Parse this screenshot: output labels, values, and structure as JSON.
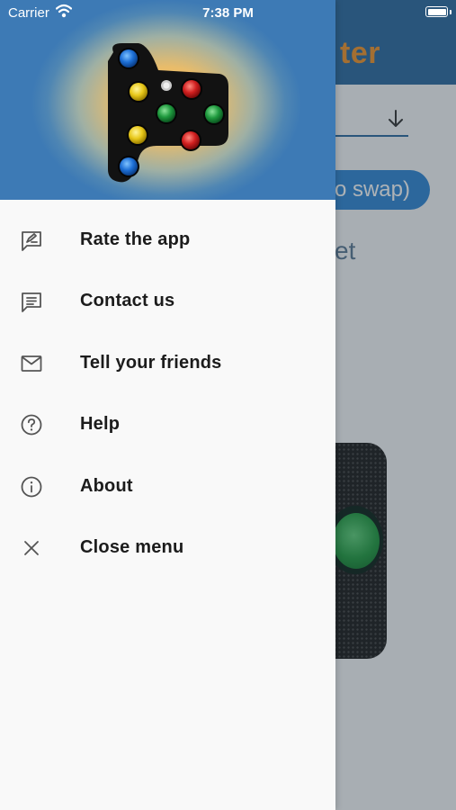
{
  "status_bar": {
    "carrier": "Carrier",
    "time": "7:38 PM"
  },
  "background_app": {
    "title_fragment": "ter",
    "button_fragment": "o swap)",
    "text_fragment": "et",
    "colors": {
      "header": "#2a6aa0",
      "accent": "#f0932b",
      "button": "#2f86d6"
    }
  },
  "drawer": {
    "menu_items": [
      {
        "label": "Rate the app",
        "icon": "rate-review-icon"
      },
      {
        "label": "Contact us",
        "icon": "chat-message-icon"
      },
      {
        "label": "Tell your friends",
        "icon": "mail-envelope-icon"
      },
      {
        "label": "Help",
        "icon": "help-circle-icon"
      },
      {
        "label": "About",
        "icon": "info-circle-icon"
      },
      {
        "label": "Close menu",
        "icon": "close-x-icon"
      }
    ]
  }
}
